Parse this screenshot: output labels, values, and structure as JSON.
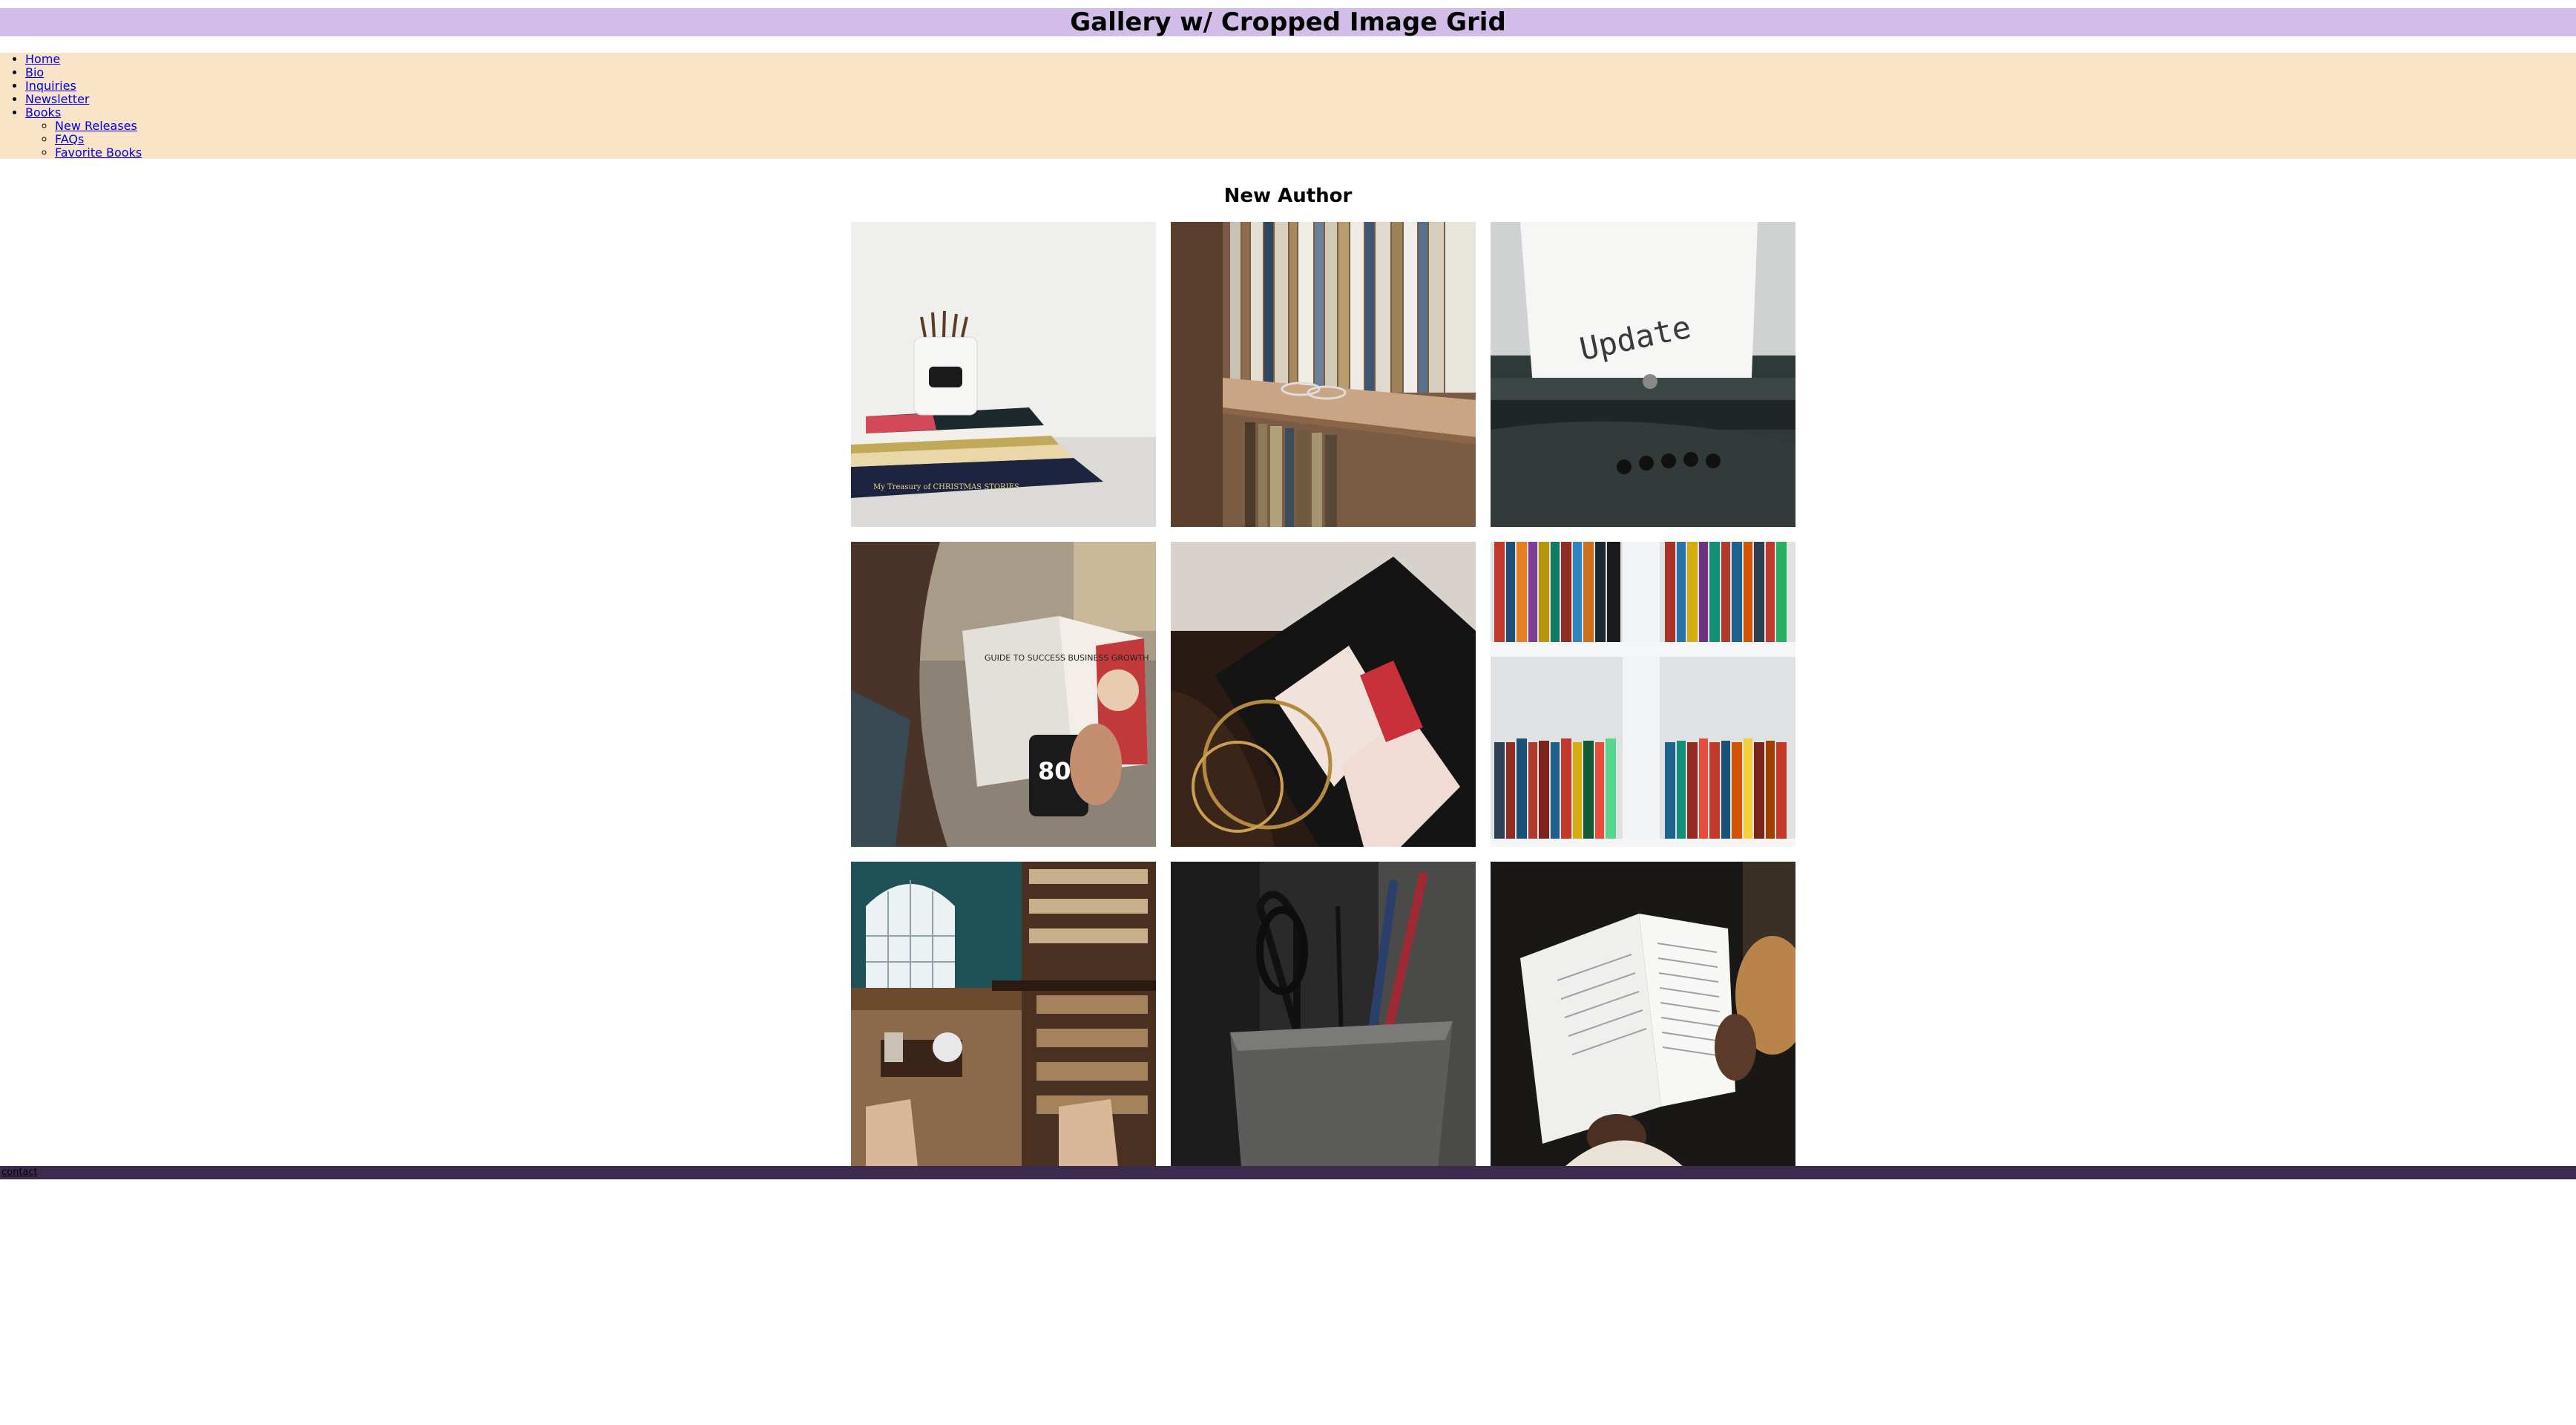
{
  "header": {
    "title": "Gallery w/ Cropped Image Grid"
  },
  "nav": {
    "items": [
      {
        "label": "Home"
      },
      {
        "label": "Bio"
      },
      {
        "label": "Inquiries"
      },
      {
        "label": "Newsletter"
      },
      {
        "label": "Books"
      }
    ],
    "books_subitems": [
      {
        "label": "New Releases"
      },
      {
        "label": "FAQs"
      },
      {
        "label": "Favorite Books"
      }
    ]
  },
  "main": {
    "heading": "New Author",
    "gallery": [
      {
        "subject": "pencil-jar-on-book-stack",
        "book_text": "My Treasury of CHRISTMAS STORIES"
      },
      {
        "subject": "bookshelf-with-glasses"
      },
      {
        "subject": "typewriter-update",
        "paper_text": "Update"
      },
      {
        "subject": "reader-with-business-book",
        "book_text": "GUIDE TO SUCCESS BUSINESS GROWTH",
        "mug_text": "80 20"
      },
      {
        "subject": "novel-cover-closeup"
      },
      {
        "subject": "colorful-bookshelf"
      },
      {
        "subject": "library-interior"
      },
      {
        "subject": "pens-in-cup"
      },
      {
        "subject": "reading-open-book"
      }
    ]
  },
  "footer": {
    "link": "contact",
    "color": "#3d2b4f"
  },
  "colors": {
    "header_bg": "#d2bde9",
    "nav_bg": "#fae4c8",
    "link": "#0000ee"
  }
}
